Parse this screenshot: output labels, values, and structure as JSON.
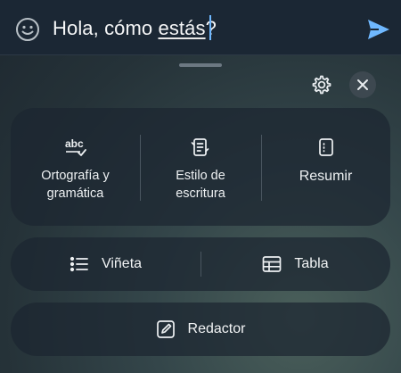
{
  "compose": {
    "text_before": "Hola, cómo ",
    "text_underlined": "estás",
    "text_after": "?",
    "emoji_icon": "smiley-icon",
    "send_icon": "send-icon"
  },
  "toolbar": {
    "settings_icon": "gear-icon",
    "close_icon": "close-icon"
  },
  "writing_tools": [
    {
      "icon": "spellcheck-abc-icon",
      "label_line1": "Ortografía y",
      "label_line2": "gramática"
    },
    {
      "icon": "rewrite-style-icon",
      "label_line1": "Estilo de",
      "label_line2": "escritura"
    },
    {
      "icon": "summarize-icon",
      "label_line1": "Resumir",
      "label_line2": ""
    }
  ],
  "format_tools": [
    {
      "icon": "bullet-list-icon",
      "label": "Viñeta"
    },
    {
      "icon": "table-icon",
      "label": "Tabla"
    }
  ],
  "redactor": {
    "icon": "compose-edit-icon",
    "label": "Redactor"
  },
  "colors": {
    "accent": "#6fb8ff",
    "topbar": "#1b2734",
    "panel": "#1c2630"
  }
}
